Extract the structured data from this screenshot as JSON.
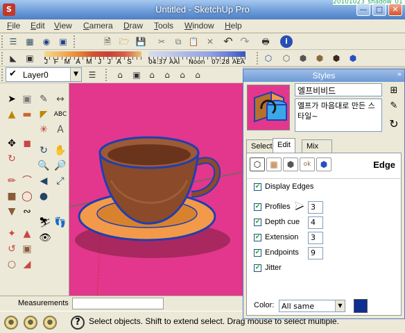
{
  "window": {
    "title": "Untitled - SketchUp Pro",
    "background_window_title": "20101023_shadow_01",
    "app_icon": "sketchup-logo-icon",
    "controls": [
      "minimize-icon",
      "maximize-icon",
      "close-icon"
    ]
  },
  "menu": [
    "File",
    "Edit",
    "View",
    "Camera",
    "Draw",
    "Tools",
    "Window",
    "Help"
  ],
  "shadow_settings": {
    "months": "J F M A M J J A S O N D",
    "time_start": "04:37",
    "am_pm_start": "ÀÀÌ",
    "noon": "Noon",
    "time_end": "07:28",
    "am_pm_end": "ÀÈÄ"
  },
  "layer": {
    "name": "Layer0"
  },
  "measurements": {
    "label": "Measurements",
    "value": ""
  },
  "status": {
    "text": "Select objects. Shift to extend select. Drag mouse to select multiple."
  },
  "styles_panel": {
    "title": "Styles",
    "style_name": "엘프비비드",
    "style_description": "엘프가 마음대로 만든 스타일~",
    "tabs": [
      "Select",
      "Edit",
      "Mix"
    ],
    "active_tab": "Edit",
    "section_title": "Edge",
    "edge_options": [
      {
        "label": "Display Edges",
        "checked": true
      },
      {
        "label": "Profiles",
        "checked": true,
        "value": "3"
      },
      {
        "label": "Depth cue",
        "checked": true,
        "value": "4"
      },
      {
        "label": "Extension",
        "checked": true,
        "value": "3"
      },
      {
        "label": "Endpoints",
        "checked": true,
        "value": "9"
      },
      {
        "label": "Jitter",
        "checked": true
      }
    ],
    "color_label": "Color:",
    "color_mode": "All same",
    "edge_color": "#0d2f8f"
  },
  "colors": {
    "viewport_background": "#e2378c",
    "cup_brown": "#8b4a2a",
    "saucer_orange": "#f29a4a",
    "edge_blue": "#1f3fb0"
  }
}
